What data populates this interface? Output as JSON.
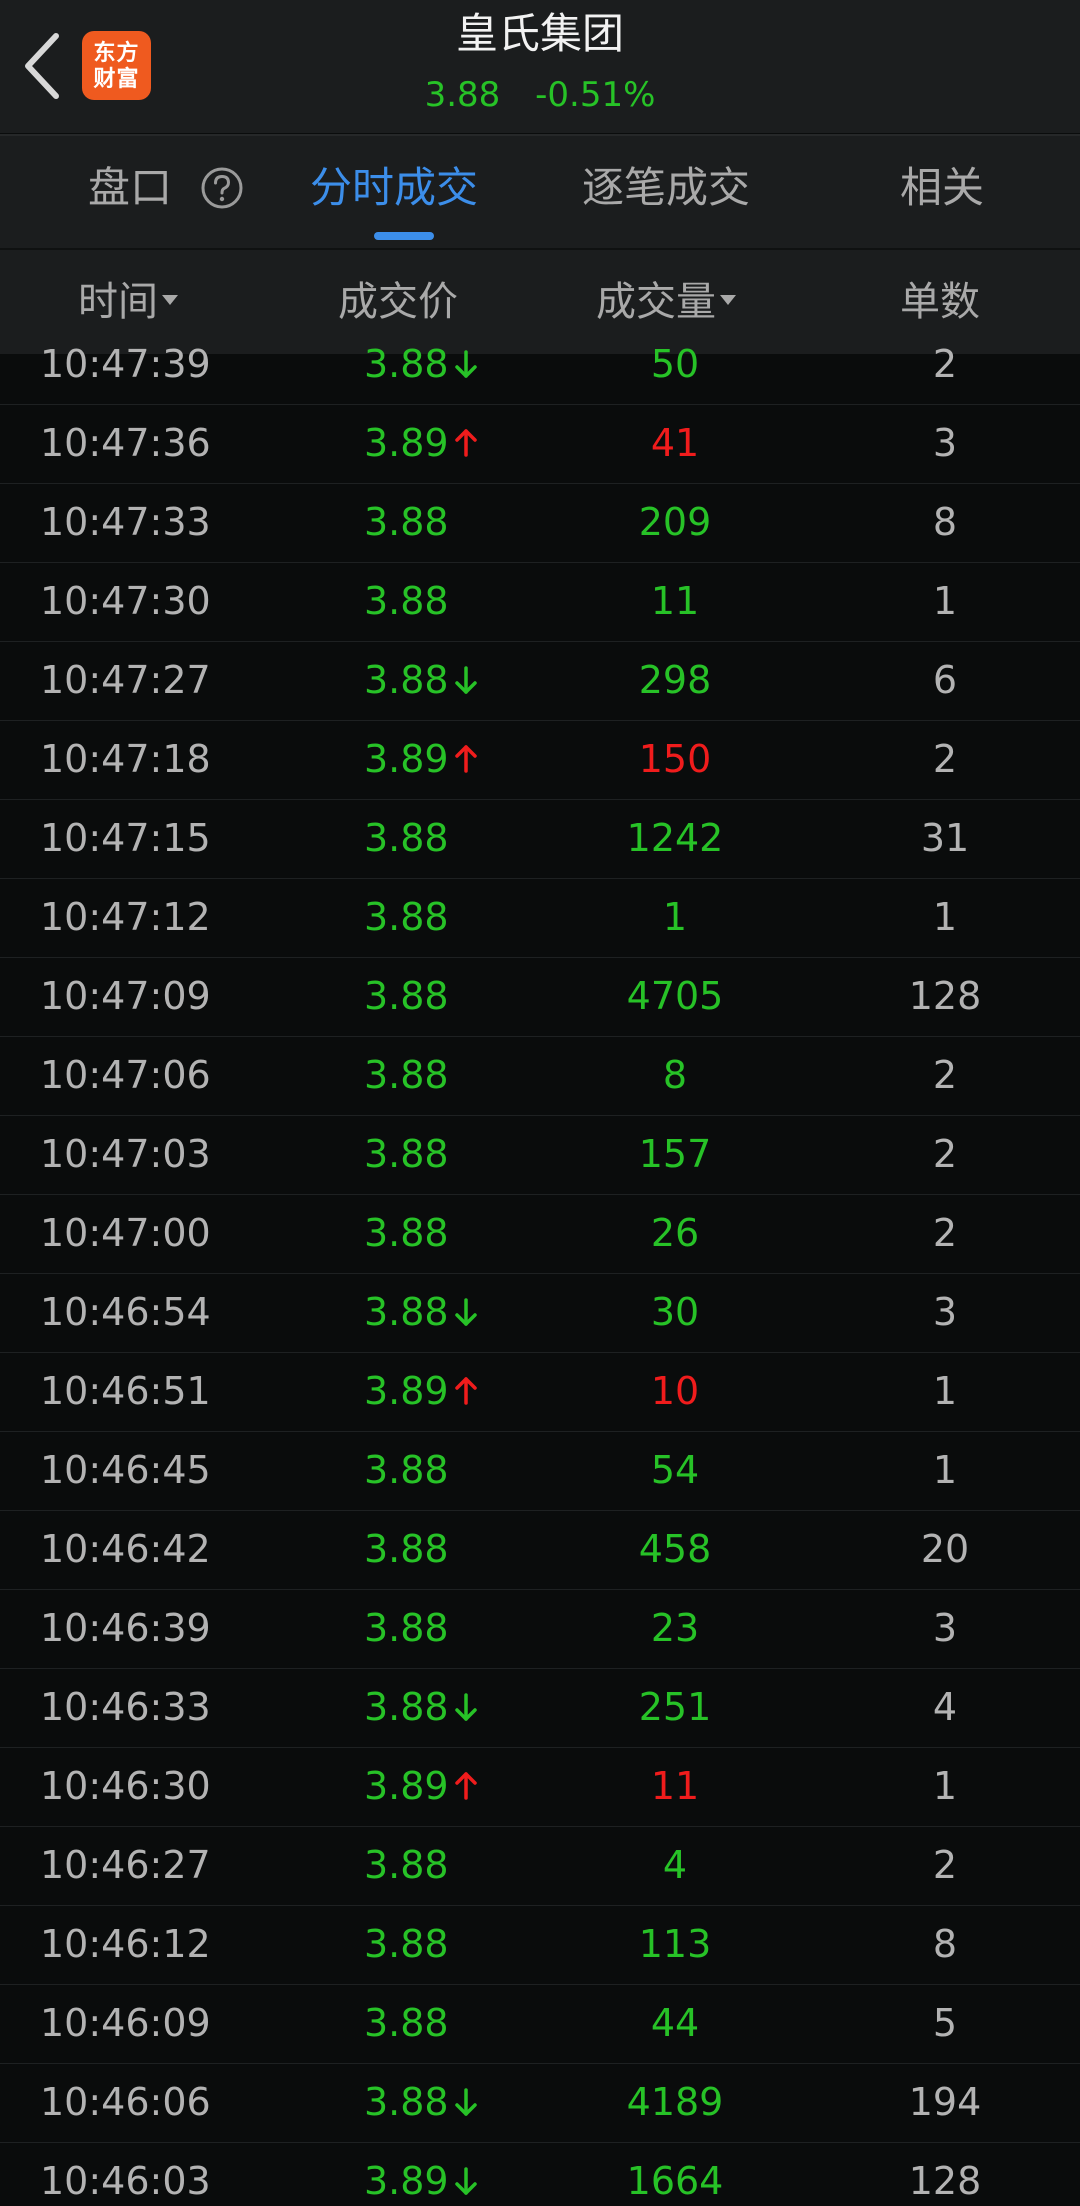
{
  "header": {
    "back_icon": "chevron-left-icon",
    "logo_line1": "东方",
    "logo_line2": "财富",
    "title": "皇氏集团",
    "price": "3.88",
    "change_pct": "-0.51%"
  },
  "tabs": [
    {
      "label": "盘口",
      "active": false
    },
    {
      "label": "分时成交",
      "active": true
    },
    {
      "label": "逐笔成交",
      "active": false
    },
    {
      "label": "相关",
      "active": false
    }
  ],
  "columns": {
    "time": "时间",
    "price": "成交价",
    "volume": "成交量",
    "count": "单数"
  },
  "colors": {
    "up": "#f01c1c",
    "down": "#27c227",
    "accent": "#3c8eea",
    "logo": "#ef5a1f"
  },
  "rows": [
    {
      "time": "10:47:39",
      "price": "3.88",
      "arrow": "down",
      "volume": "50",
      "vol_color": "green",
      "count": "2"
    },
    {
      "time": "10:47:36",
      "price": "3.89",
      "arrow": "up",
      "volume": "41",
      "vol_color": "red",
      "count": "3"
    },
    {
      "time": "10:47:33",
      "price": "3.88",
      "arrow": "",
      "volume": "209",
      "vol_color": "green",
      "count": "8"
    },
    {
      "time": "10:47:30",
      "price": "3.88",
      "arrow": "",
      "volume": "11",
      "vol_color": "green",
      "count": "1"
    },
    {
      "time": "10:47:27",
      "price": "3.88",
      "arrow": "down",
      "volume": "298",
      "vol_color": "green",
      "count": "6"
    },
    {
      "time": "10:47:18",
      "price": "3.89",
      "arrow": "up",
      "volume": "150",
      "vol_color": "red",
      "count": "2"
    },
    {
      "time": "10:47:15",
      "price": "3.88",
      "arrow": "",
      "volume": "1242",
      "vol_color": "green",
      "count": "31"
    },
    {
      "time": "10:47:12",
      "price": "3.88",
      "arrow": "",
      "volume": "1",
      "vol_color": "green",
      "count": "1"
    },
    {
      "time": "10:47:09",
      "price": "3.88",
      "arrow": "",
      "volume": "4705",
      "vol_color": "green",
      "count": "128"
    },
    {
      "time": "10:47:06",
      "price": "3.88",
      "arrow": "",
      "volume": "8",
      "vol_color": "green",
      "count": "2"
    },
    {
      "time": "10:47:03",
      "price": "3.88",
      "arrow": "",
      "volume": "157",
      "vol_color": "green",
      "count": "2"
    },
    {
      "time": "10:47:00",
      "price": "3.88",
      "arrow": "",
      "volume": "26",
      "vol_color": "green",
      "count": "2"
    },
    {
      "time": "10:46:54",
      "price": "3.88",
      "arrow": "down",
      "volume": "30",
      "vol_color": "green",
      "count": "3"
    },
    {
      "time": "10:46:51",
      "price": "3.89",
      "arrow": "up",
      "volume": "10",
      "vol_color": "red",
      "count": "1"
    },
    {
      "time": "10:46:45",
      "price": "3.88",
      "arrow": "",
      "volume": "54",
      "vol_color": "green",
      "count": "1"
    },
    {
      "time": "10:46:42",
      "price": "3.88",
      "arrow": "",
      "volume": "458",
      "vol_color": "green",
      "count": "20"
    },
    {
      "time": "10:46:39",
      "price": "3.88",
      "arrow": "",
      "volume": "23",
      "vol_color": "green",
      "count": "3"
    },
    {
      "time": "10:46:33",
      "price": "3.88",
      "arrow": "down",
      "volume": "251",
      "vol_color": "green",
      "count": "4"
    },
    {
      "time": "10:46:30",
      "price": "3.89",
      "arrow": "up",
      "volume": "11",
      "vol_color": "red",
      "count": "1"
    },
    {
      "time": "10:46:27",
      "price": "3.88",
      "arrow": "",
      "volume": "4",
      "vol_color": "green",
      "count": "2"
    },
    {
      "time": "10:46:12",
      "price": "3.88",
      "arrow": "",
      "volume": "113",
      "vol_color": "green",
      "count": "8"
    },
    {
      "time": "10:46:09",
      "price": "3.88",
      "arrow": "",
      "volume": "44",
      "vol_color": "green",
      "count": "5"
    },
    {
      "time": "10:46:06",
      "price": "3.88",
      "arrow": "down",
      "volume": "4189",
      "vol_color": "green",
      "count": "194"
    },
    {
      "time": "10:46:03",
      "price": "3.89",
      "arrow": "down",
      "volume": "1664",
      "vol_color": "green",
      "count": "128"
    }
  ]
}
